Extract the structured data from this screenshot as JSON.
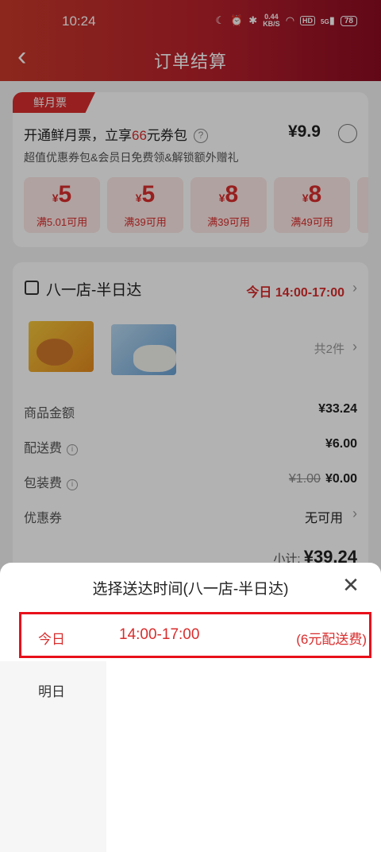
{
  "status_bar": {
    "time": "10:24",
    "net_speed_value": "0.44",
    "net_speed_unit": "KB/S",
    "hd": "HD",
    "signal": "5G",
    "battery": "78"
  },
  "nav": {
    "title": "订单结算"
  },
  "membership": {
    "tag": "鲜月票",
    "title_prefix": "开通鲜月票，立享",
    "title_highlight": "66",
    "title_suffix": "元券包",
    "price": "¥9.9",
    "subtitle": "超值优惠券包&会员日免费领&解锁额外赠礼",
    "coupons": [
      {
        "symbol": "¥",
        "amount": "5",
        "condition": "满5.01可用"
      },
      {
        "symbol": "¥",
        "amount": "5",
        "condition": "满39可用"
      },
      {
        "symbol": "¥",
        "amount": "8",
        "condition": "满39可用"
      },
      {
        "symbol": "¥",
        "amount": "8",
        "condition": "满49可用"
      }
    ]
  },
  "order": {
    "store": "八一店-半日达",
    "delivery_time": "今日 14:00-17:00",
    "item_count": "共2件",
    "rows": [
      {
        "label": "商品金额",
        "value": "¥33.24"
      },
      {
        "label": "配送费",
        "value": "¥6.00"
      },
      {
        "label": "包装费",
        "original": "¥1.00",
        "value": "¥0.00"
      },
      {
        "label": "优惠券",
        "value": "无可用"
      }
    ],
    "subtotal_label": "小计:",
    "subtotal_value": "¥39.24"
  },
  "sheet": {
    "title": "选择送达时间(八一店-半日达)",
    "days": [
      "今日",
      "明日"
    ],
    "slot": {
      "time": "14:00-17:00",
      "fee": "(6元配送费)"
    }
  },
  "colors": {
    "accent": "#d92d2d",
    "highlight_border": "#e8101a",
    "header_start": "#c8392a",
    "header_end": "#8c0c22"
  }
}
